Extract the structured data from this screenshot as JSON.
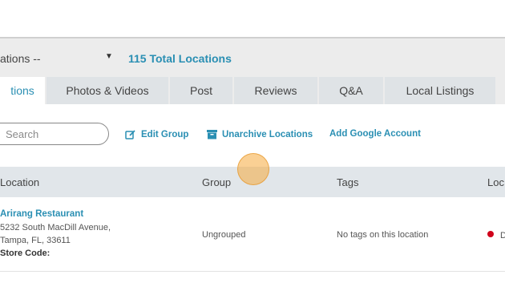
{
  "toolbar": {
    "location_select_text": "ations --",
    "total_locations": "115 Total Locations"
  },
  "tabs": [
    {
      "label": "tions",
      "active": true
    },
    {
      "label": "Photos & Videos",
      "active": false
    },
    {
      "label": "Post",
      "active": false
    },
    {
      "label": "Reviews",
      "active": false
    },
    {
      "label": "Q&A",
      "active": false
    },
    {
      "label": "Local Listings",
      "active": false
    }
  ],
  "actions": {
    "search_placeholder": "Search",
    "edit_group": "Edit Group",
    "unarchive_locations": "Unarchive Locations",
    "add_google_account": "Add Google Account"
  },
  "table": {
    "headers": [
      "Location",
      "Group",
      "Tags",
      "Loc"
    ],
    "rows": [
      {
        "name": "Arirang Restaurant",
        "address_line1": "5232 South MacDill Avenue,",
        "address_line2": "Tampa, FL, 33611",
        "store_code_label": "Store Code:",
        "group": "Ungrouped",
        "tags": "No tags on this location",
        "status_text": "D",
        "status_color": "#d0021b"
      }
    ]
  },
  "colors": {
    "accent": "#2a8fb3"
  }
}
